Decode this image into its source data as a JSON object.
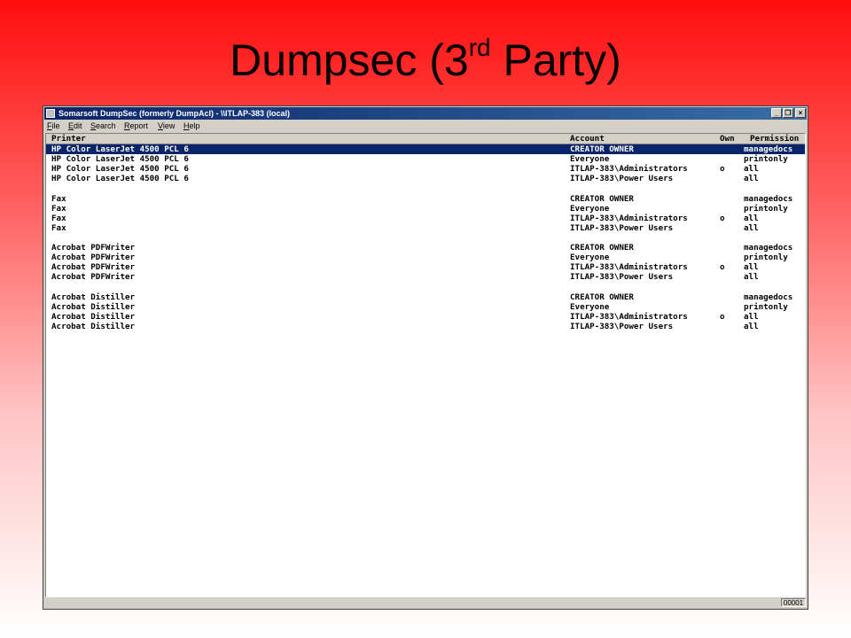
{
  "slide": {
    "title_main": "Dumpsec (3",
    "title_sup": "rd",
    "title_end": " Party)"
  },
  "window": {
    "title": "Somarsoft DumpSec (formerly DumpAcl) - \\\\ITLAP-383 (local)",
    "buttons": {
      "minimize": "_",
      "restore": "❐",
      "close": "×"
    }
  },
  "menu": [
    "File",
    "Edit",
    "Search",
    "Report",
    "View",
    "Help"
  ],
  "table": {
    "columns": {
      "printer": "Printer",
      "account": "Account",
      "own": "Own",
      "permission": "Permission"
    },
    "rows": [
      {
        "printer": "HP Color LaserJet 4500 PCL 6",
        "account": "CREATOR OWNER",
        "own": "",
        "permission": "managedocs",
        "selected": true
      },
      {
        "printer": "HP Color LaserJet 4500 PCL 6",
        "account": "Everyone",
        "own": "",
        "permission": "printonly"
      },
      {
        "printer": "HP Color LaserJet 4500 PCL 6",
        "account": "ITLAP-383\\Administrators",
        "own": "o",
        "permission": "all"
      },
      {
        "printer": "HP Color LaserJet 4500 PCL 6",
        "account": "ITLAP-383\\Power Users",
        "own": "",
        "permission": "all"
      },
      {
        "blank": true
      },
      {
        "printer": "Fax",
        "account": "CREATOR OWNER",
        "own": "",
        "permission": "managedocs"
      },
      {
        "printer": "Fax",
        "account": "Everyone",
        "own": "",
        "permission": "printonly"
      },
      {
        "printer": "Fax",
        "account": "ITLAP-383\\Administrators",
        "own": "o",
        "permission": "all"
      },
      {
        "printer": "Fax",
        "account": "ITLAP-383\\Power Users",
        "own": "",
        "permission": "all"
      },
      {
        "blank": true
      },
      {
        "printer": "Acrobat PDFWriter",
        "account": "CREATOR OWNER",
        "own": "",
        "permission": "managedocs"
      },
      {
        "printer": "Acrobat PDFWriter",
        "account": "Everyone",
        "own": "",
        "permission": "printonly"
      },
      {
        "printer": "Acrobat PDFWriter",
        "account": "ITLAP-383\\Administrators",
        "own": "o",
        "permission": "all"
      },
      {
        "printer": "Acrobat PDFWriter",
        "account": "ITLAP-383\\Power Users",
        "own": "",
        "permission": "all"
      },
      {
        "blank": true
      },
      {
        "printer": "Acrobat Distiller",
        "account": "CREATOR OWNER",
        "own": "",
        "permission": "managedocs"
      },
      {
        "printer": "Acrobat Distiller",
        "account": "Everyone",
        "own": "",
        "permission": "printonly"
      },
      {
        "printer": "Acrobat Distiller",
        "account": "ITLAP-383\\Administrators",
        "own": "o",
        "permission": "all"
      },
      {
        "printer": "Acrobat Distiller",
        "account": "ITLAP-383\\Power Users",
        "own": "",
        "permission": "all"
      }
    ]
  },
  "status": {
    "count": "00001"
  }
}
